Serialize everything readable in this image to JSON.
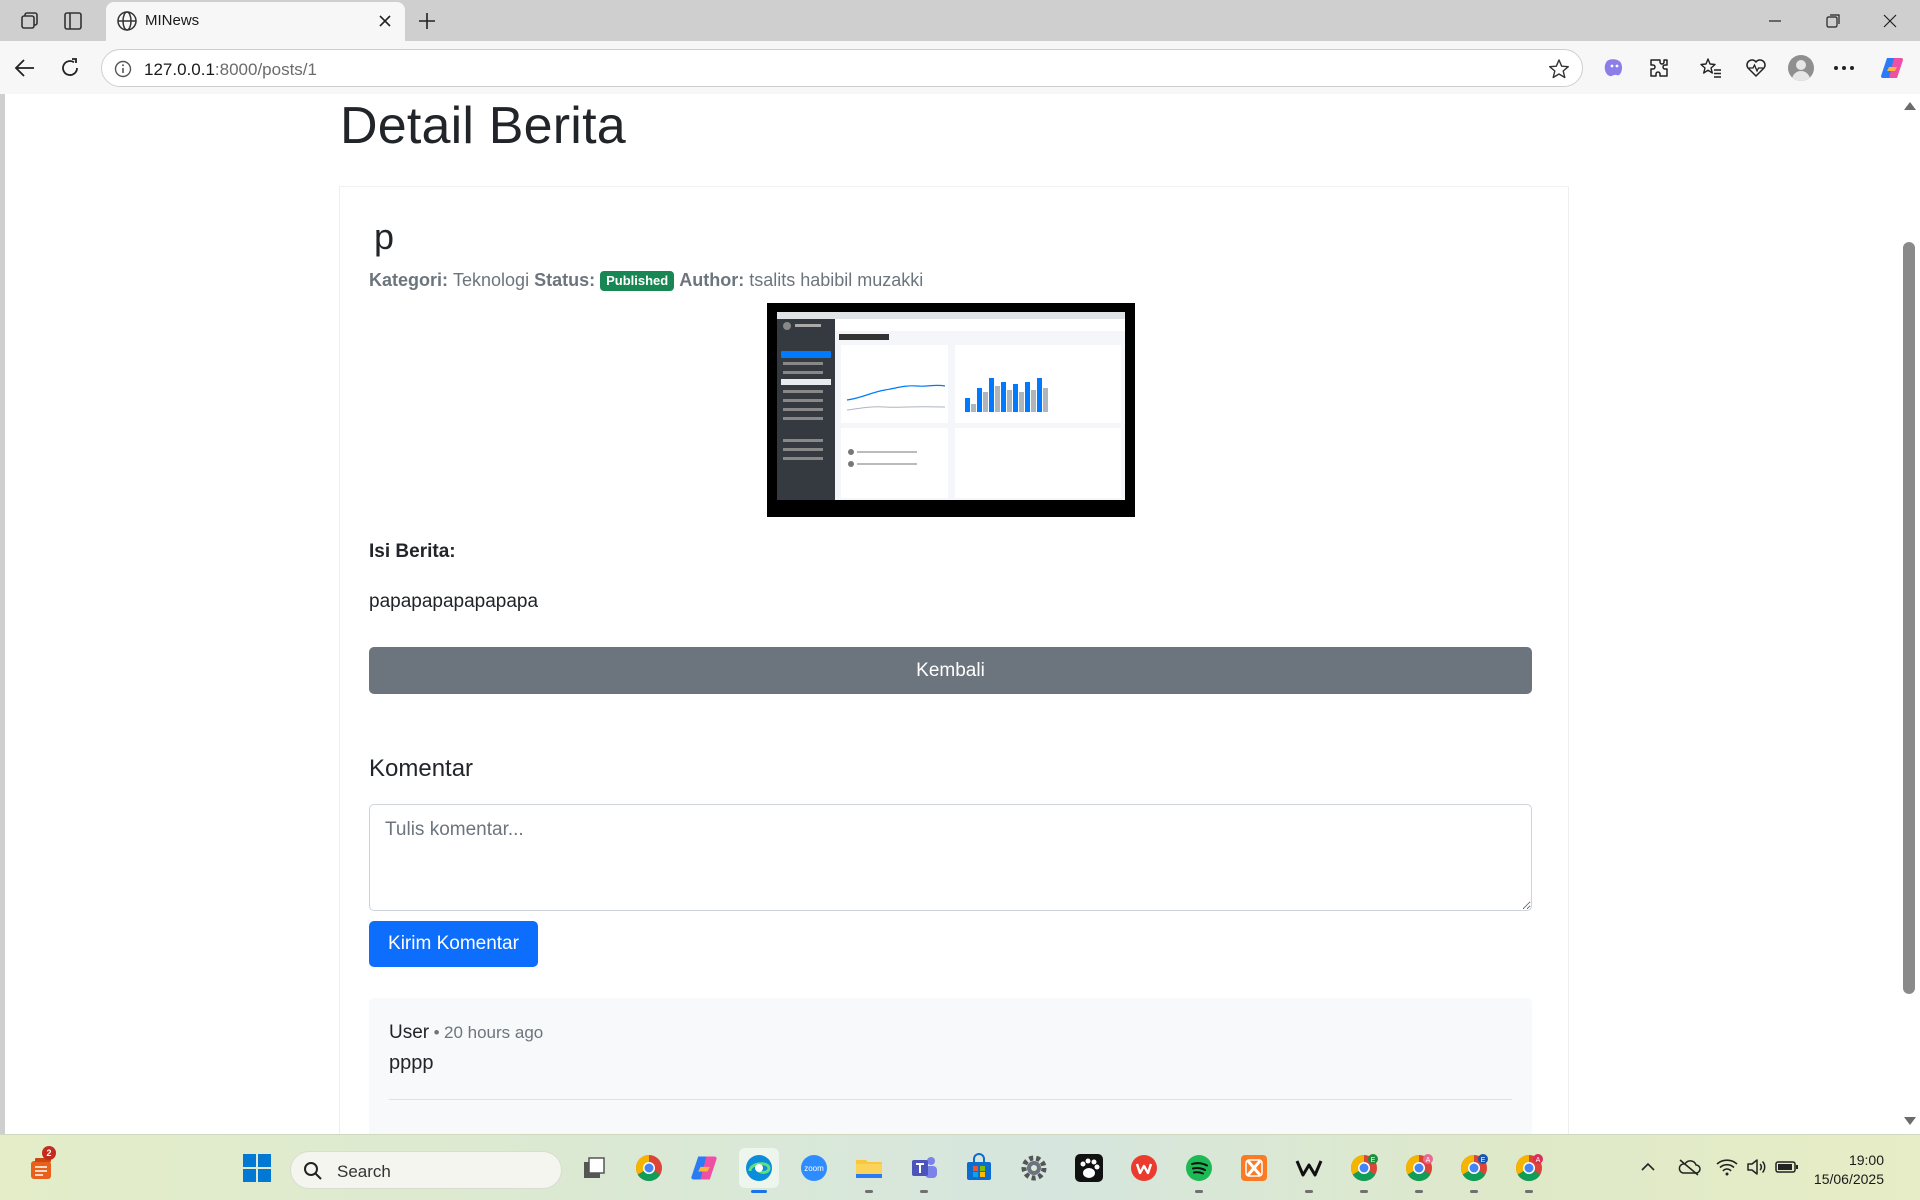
{
  "browser": {
    "tab_title": "MINews",
    "url_host": "127.0.0.1",
    "url_path": ":8000/posts/1"
  },
  "page": {
    "heading": "Detail Berita",
    "post": {
      "title": "p",
      "category_label": "Kategori:",
      "category": "Teknologi",
      "status_label": "Status:",
      "status": "Published",
      "author_label": "Author:",
      "author": "tsalits habibil muzakki",
      "content_label": "Isi Berita:",
      "content": "papapapapapapapa"
    },
    "back_button": "Kembali",
    "comments": {
      "heading": "Komentar",
      "placeholder": "Tulis komentar...",
      "submit_label": "Kirim Komentar",
      "items": [
        {
          "author": "User",
          "separator": "•",
          "time": "20 hours ago",
          "body": "pppp"
        }
      ]
    }
  },
  "taskbar": {
    "search_label": "Search",
    "time": "19:00",
    "date": "15/06/2025",
    "notification_badge": "2",
    "colors": {
      "start": "#0078d4",
      "edge_active": "#1a73e8"
    }
  },
  "colors": {
    "btn_secondary": "#6c757d",
    "btn_primary": "#0d6efd",
    "badge_success": "#198754"
  }
}
